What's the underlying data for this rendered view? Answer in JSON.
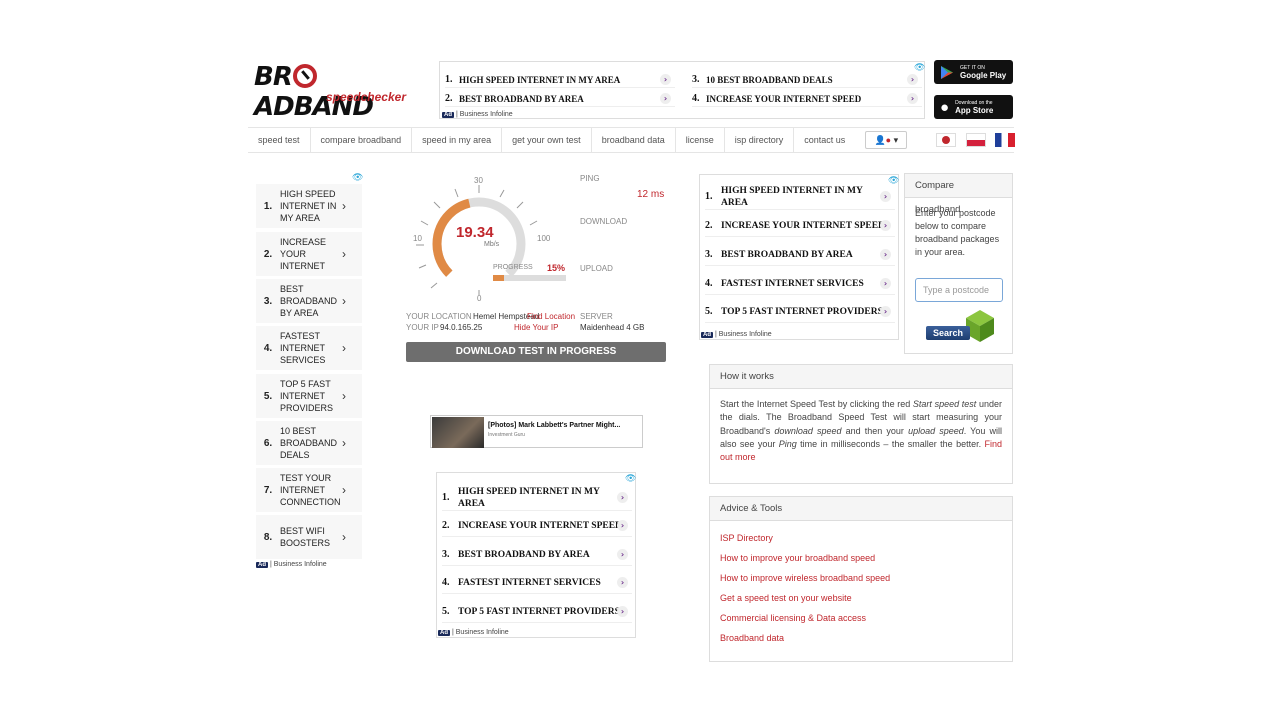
{
  "logo": {
    "main": "BROADBAND",
    "sub": "speedchecker"
  },
  "top_ad": {
    "items": [
      {
        "n": "1.",
        "label": "HIGH SPEED INTERNET IN MY AREA"
      },
      {
        "n": "2.",
        "label": "BEST BROADBAND BY AREA"
      },
      {
        "n": "3.",
        "label": "10 BEST BROADBAND DEALS"
      },
      {
        "n": "4.",
        "label": "INCREASE YOUR INTERNET SPEED"
      }
    ],
    "badge": "Ad",
    "source": "| Business Infoline"
  },
  "stores": {
    "google_small": "GET IT ON",
    "google_big": "Google Play",
    "apple_small": "Download on the",
    "apple_big": "App Store"
  },
  "nav": {
    "items": [
      "speed test",
      "compare broadband",
      "speed in my area",
      "get your own test",
      "broadband data",
      "license",
      "isp directory",
      "contact us"
    ]
  },
  "left_ad": {
    "items": [
      {
        "n": "1.",
        "label": "HIGH SPEED INTERNET IN MY AREA"
      },
      {
        "n": "2.",
        "label": "INCREASE YOUR INTERNET"
      },
      {
        "n": "3.",
        "label": "BEST BROADBAND BY AREA"
      },
      {
        "n": "4.",
        "label": "FASTEST INTERNET SERVICES"
      },
      {
        "n": "5.",
        "label": "TOP 5 FAST INTERNET PROVIDERS"
      },
      {
        "n": "6.",
        "label": "10 BEST BROADBAND DEALS"
      },
      {
        "n": "7.",
        "label": "TEST YOUR INTERNET CONNECTION"
      },
      {
        "n": "8.",
        "label": "BEST WIFI BOOSTERS"
      }
    ],
    "badge": "Ad",
    "source": "| Business Infoline"
  },
  "speedtest": {
    "gauge_value": "19.34",
    "gauge_unit": "Mb/s",
    "gauge_fraction": 0.45,
    "ticks": {
      "t0": "0",
      "t10": "10",
      "t30": "30",
      "t100": "100"
    },
    "ping_label": "PING",
    "ping_value": "12 ms",
    "download_label": "DOWNLOAD",
    "upload_label": "UPLOAD",
    "progress_label": "PROGRESS",
    "progress_value": "15%",
    "progress_fraction": 0.15,
    "location_label": "YOUR LOCATION",
    "location_value": "Hemel Hempstead",
    "find_location": "Find Location",
    "ip_label": "YOUR IP",
    "ip_value": "94.0.165.25",
    "hide_ip": "Hide Your IP",
    "server_label": "SERVER",
    "server_value": "Maidenhead 4 GB",
    "status_button": "DOWNLOAD TEST IN PROGRESS"
  },
  "news_ad": {
    "title": "[Photos] Mark Labbett's Partner Might...",
    "source": "Investment Guru"
  },
  "mid_ad": {
    "items": [
      {
        "n": "1.",
        "label": "HIGH SPEED INTERNET IN MY AREA"
      },
      {
        "n": "2.",
        "label": "INCREASE YOUR INTERNET SPEED"
      },
      {
        "n": "3.",
        "label": "BEST BROADBAND BY AREA"
      },
      {
        "n": "4.",
        "label": "FASTEST INTERNET SERVICES"
      },
      {
        "n": "5.",
        "label": "TOP 5 FAST INTERNET PROVIDERS"
      }
    ],
    "badge": "Ad",
    "source": "| Business Infoline"
  },
  "right_ad": {
    "items": [
      {
        "n": "1.",
        "label": "HIGH SPEED INTERNET IN MY AREA"
      },
      {
        "n": "2.",
        "label": "INCREASE YOUR INTERNET SPEED"
      },
      {
        "n": "3.",
        "label": "BEST BROADBAND BY AREA"
      },
      {
        "n": "4.",
        "label": "FASTEST INTERNET SERVICES"
      },
      {
        "n": "5.",
        "label": "TOP 5 FAST INTERNET PROVIDERS"
      }
    ],
    "badge": "Ad",
    "source": "| Business Infoline"
  },
  "compare": {
    "title": "Compare broadband",
    "text": "Enter your postcode below to compare broadband packages in your area.",
    "placeholder": "Type a postcode",
    "search": "Search"
  },
  "how": {
    "title": "How it works",
    "t1": "Start the Internet Speed Test by clicking the red ",
    "t1i": "Start speed test",
    "t2": " under the dials. The Broadband Speed Test will start measuring your Broadband's ",
    "t2i": "download speed",
    "t3": " and then your ",
    "t3i": "upload speed",
    "t4": ". You will also see your ",
    "t4i": "Ping",
    "t5": " time in milliseconds – the smaller the better. ",
    "link": "Find out more"
  },
  "advice": {
    "title": "Advice & Tools",
    "links": [
      "ISP Directory",
      "How to improve your broadband speed",
      "How to improve wireless broadband speed",
      "Get a speed test on your website",
      "Commercial licensing & Data access",
      "Broadband data"
    ]
  },
  "colors": {
    "accent": "#c0272d",
    "gauge": "#e08a45",
    "button": "#6e6e6e"
  }
}
